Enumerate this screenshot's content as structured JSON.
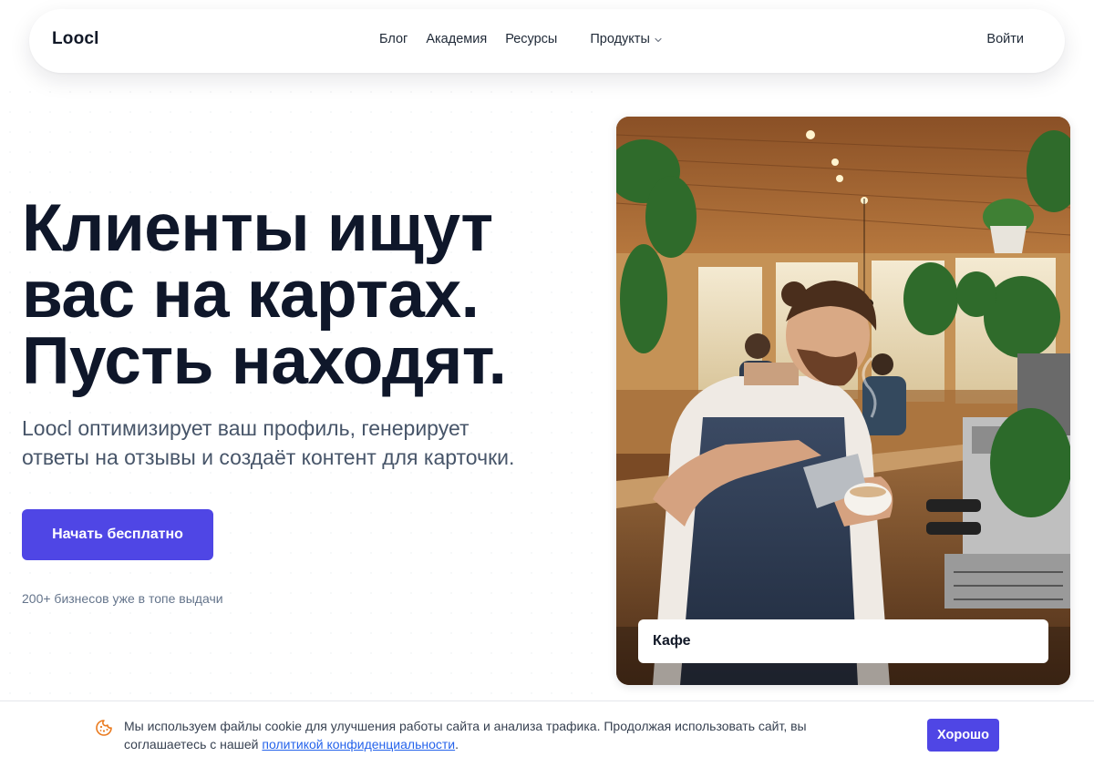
{
  "nav": {
    "logo": "Loocl",
    "links": [
      "Блог",
      "Академия",
      "Ресурсы"
    ],
    "products_label": "Продукты",
    "login_label": "Войти"
  },
  "hero": {
    "title_lines": [
      "Клиенты ищут",
      "вас на картах.",
      "Пусть находят."
    ],
    "subtitle_lines": [
      "Loocl оптимизирует ваш профиль, генерирует",
      "ответы на отзывы и создаёт контент для карточки."
    ],
    "cta_label": "Начать бесплатно",
    "social_proof": "200+ бизнесов уже в топе выдачи"
  },
  "photo_card": {
    "label": "Кафе"
  },
  "cookie": {
    "text_line1": "Мы используем файлы cookie для улучшения работы сайта и анализа трафика. Продолжая использовать сайт, вы",
    "text_line2_before": "соглашаетесь с нашей ",
    "link_label": "политикой конфиденциальности",
    "text_line2_after": ".",
    "accept_label": "Хорошо"
  },
  "colors": {
    "accent": "#4f46e5",
    "heading": "#0f172a",
    "link": "#2563eb"
  }
}
